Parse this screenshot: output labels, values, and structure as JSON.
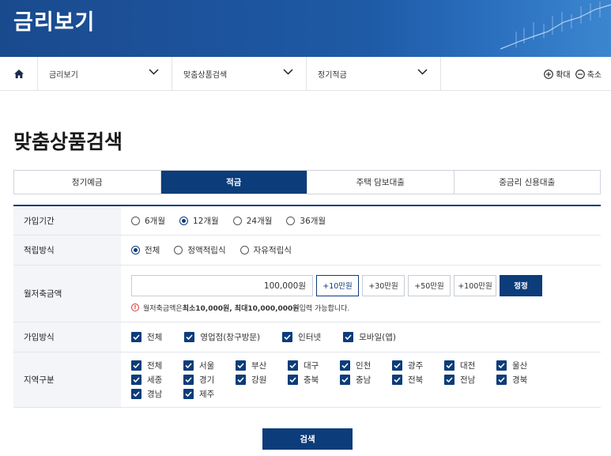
{
  "header": {
    "title": "금리보기"
  },
  "nav": {
    "items": [
      "금리보기",
      "맞춤상품검색",
      "정기적금"
    ],
    "zoom_in": "확대",
    "zoom_out": "축소"
  },
  "page_title": "맞춤상품검색",
  "tabs": [
    {
      "label": "정기예금",
      "active": false
    },
    {
      "label": "적금",
      "active": true
    },
    {
      "label": "주택 담보대출",
      "active": false
    },
    {
      "label": "중금리 신용대출",
      "active": false
    }
  ],
  "form": {
    "period": {
      "label": "가입기간",
      "options": [
        "6개월",
        "12개월",
        "24개월",
        "36개월"
      ],
      "selected": "12개월"
    },
    "method": {
      "label": "적립방식",
      "options": [
        "전체",
        "정액적립식",
        "자유적립식"
      ],
      "selected": "전체"
    },
    "amount": {
      "label": "월저축금액",
      "value": "100,000원",
      "buttons": [
        "+10만원",
        "+30만원",
        "+50만원",
        "+100만원"
      ],
      "reset": "정정",
      "note_prefix": "월저축금액은 ",
      "note_bold": "최소10,000원, 최대10,000,000원",
      "note_suffix": " 입력 가능합니다."
    },
    "join": {
      "label": "가입방식",
      "options": [
        "전체",
        "영업점(창구방문)",
        "인터넷",
        "모바일(앱)"
      ]
    },
    "region": {
      "label": "지역구분",
      "options": [
        "전체",
        "서울",
        "부산",
        "대구",
        "인천",
        "광주",
        "대전",
        "울산",
        "세종",
        "경기",
        "강원",
        "충북",
        "충남",
        "전북",
        "전남",
        "경북",
        "경남",
        "제주"
      ]
    }
  },
  "search_label": "검색",
  "colors": {
    "primary": "#0c3c7a",
    "banner": "#1e5aa6"
  }
}
